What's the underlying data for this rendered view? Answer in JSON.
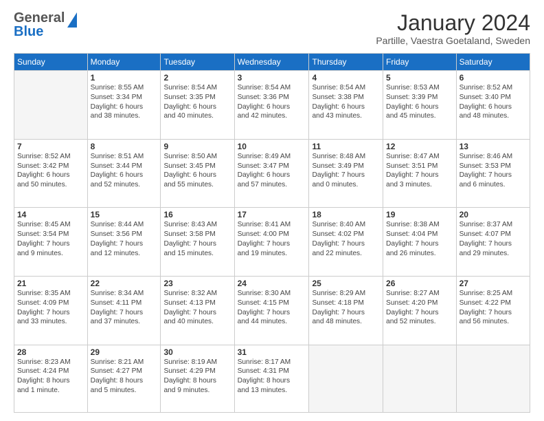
{
  "header": {
    "logo": {
      "general": "General",
      "blue": "Blue"
    },
    "title": "January 2024",
    "location": "Partille, Vaestra Goetaland, Sweden"
  },
  "weekdays": [
    "Sunday",
    "Monday",
    "Tuesday",
    "Wednesday",
    "Thursday",
    "Friday",
    "Saturday"
  ],
  "weeks": [
    [
      {
        "day": "",
        "info": ""
      },
      {
        "day": "1",
        "info": "Sunrise: 8:55 AM\nSunset: 3:34 PM\nDaylight: 6 hours\nand 38 minutes."
      },
      {
        "day": "2",
        "info": "Sunrise: 8:54 AM\nSunset: 3:35 PM\nDaylight: 6 hours\nand 40 minutes."
      },
      {
        "day": "3",
        "info": "Sunrise: 8:54 AM\nSunset: 3:36 PM\nDaylight: 6 hours\nand 42 minutes."
      },
      {
        "day": "4",
        "info": "Sunrise: 8:54 AM\nSunset: 3:38 PM\nDaylight: 6 hours\nand 43 minutes."
      },
      {
        "day": "5",
        "info": "Sunrise: 8:53 AM\nSunset: 3:39 PM\nDaylight: 6 hours\nand 45 minutes."
      },
      {
        "day": "6",
        "info": "Sunrise: 8:52 AM\nSunset: 3:40 PM\nDaylight: 6 hours\nand 48 minutes."
      }
    ],
    [
      {
        "day": "7",
        "info": "Sunrise: 8:52 AM\nSunset: 3:42 PM\nDaylight: 6 hours\nand 50 minutes."
      },
      {
        "day": "8",
        "info": "Sunrise: 8:51 AM\nSunset: 3:44 PM\nDaylight: 6 hours\nand 52 minutes."
      },
      {
        "day": "9",
        "info": "Sunrise: 8:50 AM\nSunset: 3:45 PM\nDaylight: 6 hours\nand 55 minutes."
      },
      {
        "day": "10",
        "info": "Sunrise: 8:49 AM\nSunset: 3:47 PM\nDaylight: 6 hours\nand 57 minutes."
      },
      {
        "day": "11",
        "info": "Sunrise: 8:48 AM\nSunset: 3:49 PM\nDaylight: 7 hours\nand 0 minutes."
      },
      {
        "day": "12",
        "info": "Sunrise: 8:47 AM\nSunset: 3:51 PM\nDaylight: 7 hours\nand 3 minutes."
      },
      {
        "day": "13",
        "info": "Sunrise: 8:46 AM\nSunset: 3:53 PM\nDaylight: 7 hours\nand 6 minutes."
      }
    ],
    [
      {
        "day": "14",
        "info": "Sunrise: 8:45 AM\nSunset: 3:54 PM\nDaylight: 7 hours\nand 9 minutes."
      },
      {
        "day": "15",
        "info": "Sunrise: 8:44 AM\nSunset: 3:56 PM\nDaylight: 7 hours\nand 12 minutes."
      },
      {
        "day": "16",
        "info": "Sunrise: 8:43 AM\nSunset: 3:58 PM\nDaylight: 7 hours\nand 15 minutes."
      },
      {
        "day": "17",
        "info": "Sunrise: 8:41 AM\nSunset: 4:00 PM\nDaylight: 7 hours\nand 19 minutes."
      },
      {
        "day": "18",
        "info": "Sunrise: 8:40 AM\nSunset: 4:02 PM\nDaylight: 7 hours\nand 22 minutes."
      },
      {
        "day": "19",
        "info": "Sunrise: 8:38 AM\nSunset: 4:04 PM\nDaylight: 7 hours\nand 26 minutes."
      },
      {
        "day": "20",
        "info": "Sunrise: 8:37 AM\nSunset: 4:07 PM\nDaylight: 7 hours\nand 29 minutes."
      }
    ],
    [
      {
        "day": "21",
        "info": "Sunrise: 8:35 AM\nSunset: 4:09 PM\nDaylight: 7 hours\nand 33 minutes."
      },
      {
        "day": "22",
        "info": "Sunrise: 8:34 AM\nSunset: 4:11 PM\nDaylight: 7 hours\nand 37 minutes."
      },
      {
        "day": "23",
        "info": "Sunrise: 8:32 AM\nSunset: 4:13 PM\nDaylight: 7 hours\nand 40 minutes."
      },
      {
        "day": "24",
        "info": "Sunrise: 8:30 AM\nSunset: 4:15 PM\nDaylight: 7 hours\nand 44 minutes."
      },
      {
        "day": "25",
        "info": "Sunrise: 8:29 AM\nSunset: 4:18 PM\nDaylight: 7 hours\nand 48 minutes."
      },
      {
        "day": "26",
        "info": "Sunrise: 8:27 AM\nSunset: 4:20 PM\nDaylight: 7 hours\nand 52 minutes."
      },
      {
        "day": "27",
        "info": "Sunrise: 8:25 AM\nSunset: 4:22 PM\nDaylight: 7 hours\nand 56 minutes."
      }
    ],
    [
      {
        "day": "28",
        "info": "Sunrise: 8:23 AM\nSunset: 4:24 PM\nDaylight: 8 hours\nand 1 minute."
      },
      {
        "day": "29",
        "info": "Sunrise: 8:21 AM\nSunset: 4:27 PM\nDaylight: 8 hours\nand 5 minutes."
      },
      {
        "day": "30",
        "info": "Sunrise: 8:19 AM\nSunset: 4:29 PM\nDaylight: 8 hours\nand 9 minutes."
      },
      {
        "day": "31",
        "info": "Sunrise: 8:17 AM\nSunset: 4:31 PM\nDaylight: 8 hours\nand 13 minutes."
      },
      {
        "day": "",
        "info": ""
      },
      {
        "day": "",
        "info": ""
      },
      {
        "day": "",
        "info": ""
      }
    ]
  ]
}
